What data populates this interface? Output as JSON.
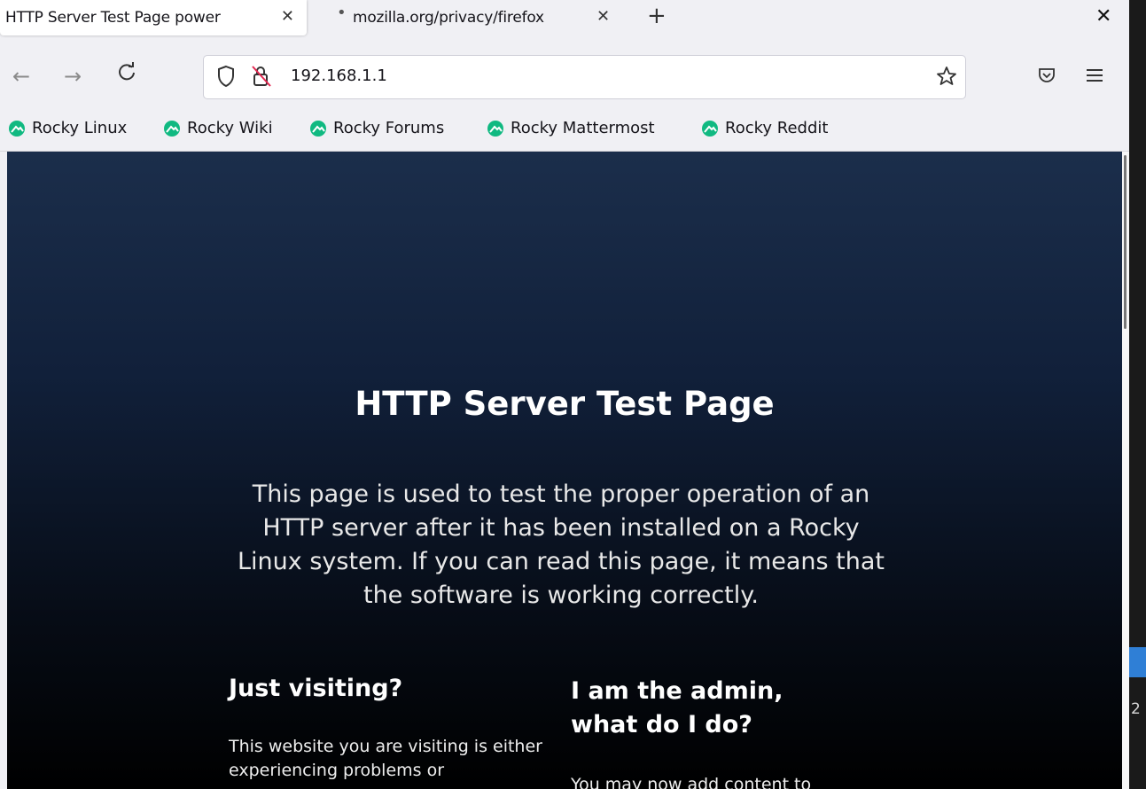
{
  "tabs": [
    {
      "label": "HTTP Server Test Page power",
      "active": true
    },
    {
      "label": "mozilla.org/privacy/firefox",
      "active": false
    }
  ],
  "toolbar": {
    "back_icon": "back-arrow-icon",
    "forward_icon": "forward-arrow-icon",
    "reload_icon": "reload-icon",
    "url": "192.168.1.1"
  },
  "bookmarks": [
    {
      "label": "Rocky Linux"
    },
    {
      "label": "Rocky Wiki"
    },
    {
      "label": "Rocky Forums"
    },
    {
      "label": "Rocky Mattermost"
    },
    {
      "label": "Rocky Reddit"
    }
  ],
  "page": {
    "title": "HTTP Server Test Page",
    "lead": "This page is used to test the proper operation of an HTTP server after it has been installed on a Rocky Linux system. If you can read this page, it means that the software is working correctly.",
    "col1_heading": "Just visiting?",
    "col1_text": "This website you are visiting is either experiencing problems or",
    "col2_heading": "I am the admin, what do I do?",
    "col2_text": "You may now add content to"
  },
  "side_strip": {
    "digit": "2"
  },
  "colors": {
    "accent_green": "#10b981",
    "page_bg_top": "#1b2e4b",
    "page_bg_bottom": "#000000"
  }
}
